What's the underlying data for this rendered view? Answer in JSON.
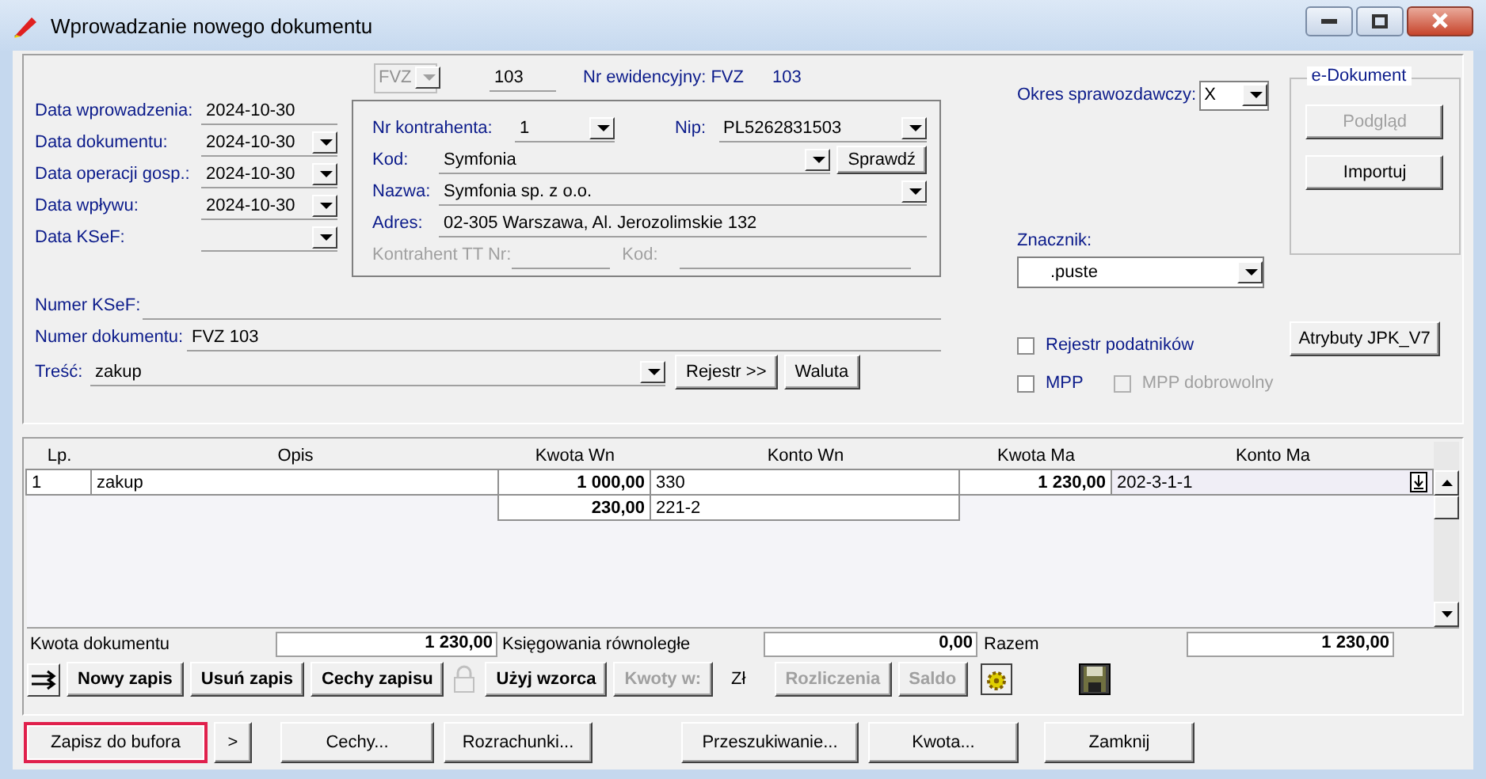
{
  "window": {
    "title": "Wprowadzanie nowego dokumentu"
  },
  "dates": [
    {
      "label": "Data wprowadzenia:",
      "value": "2024-10-30",
      "kind": "text"
    },
    {
      "label": "Data dokumentu:",
      "value": "2024-10-30",
      "kind": "dropdown"
    },
    {
      "label": "Data operacji gosp.:",
      "value": "2024-10-30",
      "kind": "dropdown"
    },
    {
      "label": "Data wpływu:",
      "value": "2024-10-30",
      "kind": "dropdown"
    },
    {
      "label": "Data KSeF:",
      "kind": "dropdown"
    }
  ],
  "series": {
    "value": "FVZ",
    "disabled": true
  },
  "number": "103",
  "register": {
    "label": "Nr ewidencyjny: FVZ",
    "value": "103"
  },
  "contractor": {
    "number": {
      "label": "Nr kontrahenta:",
      "value": "1"
    },
    "nip": {
      "label": "Nip:",
      "value": "PL5262831503"
    },
    "code": {
      "label": "Kod:",
      "value": "Symfonia"
    },
    "check_button": "Sprawdź",
    "name": {
      "label": "Nazwa:",
      "value": "Symfonia sp. z o.o."
    },
    "address": {
      "label": "Adres:",
      "value": "02-305 Warszawa, Al. Jerozolimskie 132"
    },
    "tt_number": {
      "label": "Kontrahent TT Nr:",
      "disabled": true
    },
    "tt_code": {
      "label": "Kod:",
      "disabled": true
    }
  },
  "ksef_number": {
    "label": "Numer KSeF:"
  },
  "document_number": {
    "label": "Numer dokumentu:",
    "value": "FVZ 103"
  },
  "content": {
    "label": "Treść:",
    "value": "zakup"
  },
  "content_buttons": [
    {
      "label": "Rejestr >>"
    },
    {
      "label": "Waluta"
    }
  ],
  "period": {
    "label": "Okres sprawozdawczy:",
    "value": "X"
  },
  "marker": {
    "label": "Znacznik:",
    "value": ".puste"
  },
  "checkboxes": [
    {
      "label": "Rejestr podatników",
      "checked": false,
      "disabled": false
    },
    {
      "label": "MPP",
      "checked": false,
      "disabled": false
    },
    {
      "label": "MPP dobrowolny",
      "checked": false,
      "disabled": true
    }
  ],
  "e_document": {
    "title": "e-Dokument",
    "buttons": [
      {
        "label": "Podgląd",
        "disabled": true
      },
      {
        "label": "Importuj",
        "disabled": false
      }
    ]
  },
  "jpk_button": "Atrybuty JPK_V7",
  "table": {
    "columns": [
      "Lp.",
      "Opis",
      "Kwota Wn",
      "Konto Wn",
      "Kwota Ma",
      "Konto Ma"
    ],
    "rows": [
      {
        "lp": "1",
        "description": "zakup",
        "debit_amount": "1 000,00",
        "debit_account": "330",
        "credit_amount": "1 230,00",
        "credit_account": "202-3-1-1"
      },
      {
        "debit_amount": "230,00",
        "debit_account": "221-2"
      }
    ]
  },
  "totals": [
    {
      "label": "Kwota dokumentu",
      "value": "1 230,00"
    },
    {
      "label": "Księgowania równoległe",
      "value": "0,00"
    },
    {
      "label": "Razem",
      "value": "1 230,00"
    }
  ],
  "toolbar": {
    "entry_buttons": [
      {
        "label": "Nowy zapis"
      },
      {
        "label": "Usuń zapis"
      },
      {
        "label": "Cechy zapisu"
      }
    ],
    "lock_disabled": true,
    "template_button": {
      "label": "Użyj wzorca",
      "disabled": false
    },
    "amounts_button": {
      "label": "Kwoty w:",
      "disabled": true
    },
    "currency": "Zł",
    "settlement_buttons": [
      {
        "label": "Rozliczenia",
        "disabled": true
      },
      {
        "label": "Saldo",
        "disabled": true
      }
    ]
  },
  "footer_buttons": [
    {
      "label": "Zapisz do bufora",
      "highlighted": true
    },
    {
      "label": ">",
      "highlighted": false
    },
    {
      "label": "Cechy...",
      "highlighted": false
    },
    {
      "label": "Rozrachunki...",
      "highlighted": false
    },
    {
      "label": "Przeszukiwanie...",
      "highlighted": false
    },
    {
      "label": "Kwota...",
      "highlighted": false
    },
    {
      "label": "Zamknij",
      "highlighted": false
    }
  ]
}
